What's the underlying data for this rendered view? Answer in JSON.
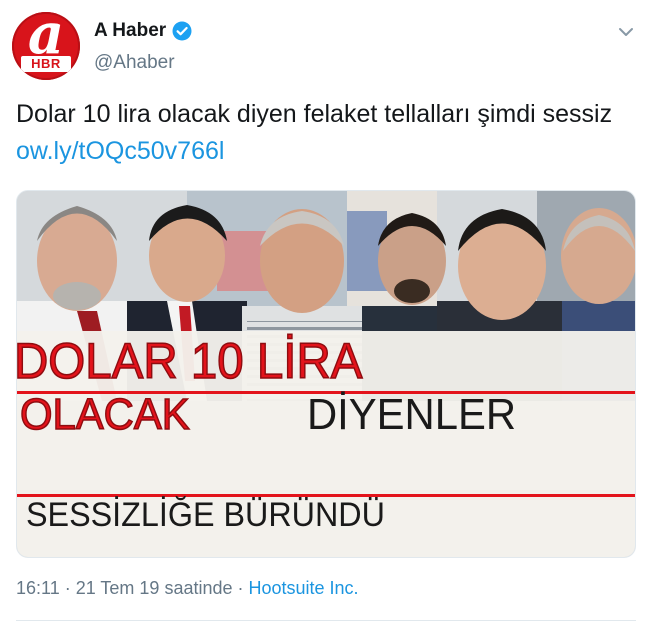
{
  "account": {
    "avatar_letter": "a",
    "avatar_badge": "HBR",
    "name": "A Haber",
    "handle": "@Ahaber"
  },
  "tweet": {
    "text": "Dolar 10 lira olacak diyen felaket tellalları şimdi sessiz ",
    "link": "ow.ly/tOQc50v766l"
  },
  "media": {
    "headline_line1": "DOLAR 10 LİRA",
    "headline_line2_red": "OLACAK",
    "headline_line2_black": "DİYENLER",
    "headline_line3": "SESSİZLİĞE BÜRÜNDÜ"
  },
  "meta": {
    "time": "16:11",
    "separator": " · ",
    "date": "21 Tem 19 saatinde",
    "source": "Hootsuite Inc."
  },
  "colors": {
    "brand_red": "#d8141b",
    "link_blue": "#1b95e0",
    "secondary_gray": "#657786"
  }
}
